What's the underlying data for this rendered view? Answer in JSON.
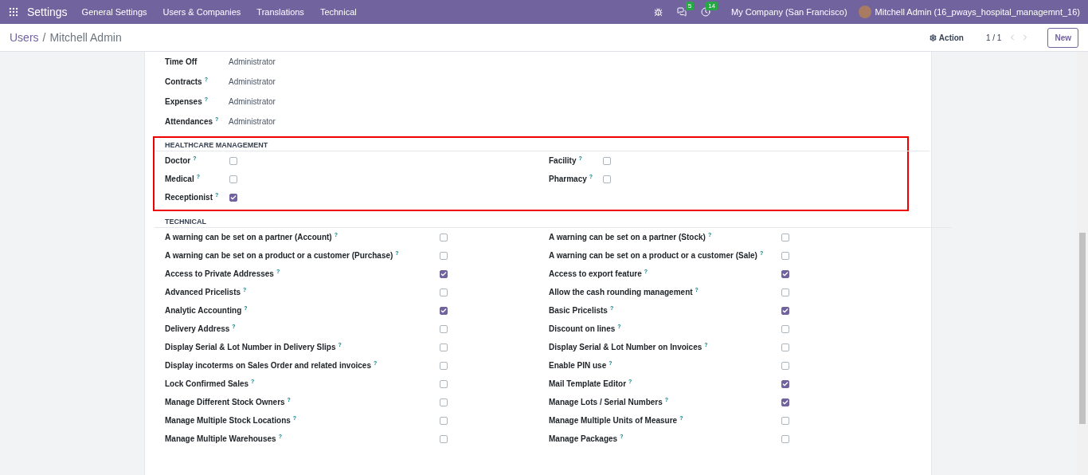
{
  "navbar": {
    "app": "Settings",
    "menus": [
      "General Settings",
      "Users & Companies",
      "Translations",
      "Technical"
    ],
    "messages_count": "5",
    "activities_count": "14",
    "company": "My Company (San Francisco)",
    "user": "Mitchell Admin (16_pways_hospital_managemnt_16)"
  },
  "control_panel": {
    "breadcrumb_parent": "Users",
    "separator": "/",
    "breadcrumb_current": "Mitchell Admin",
    "action": "Action",
    "pager": "1 / 1",
    "new_button": "New"
  },
  "access_rows": [
    {
      "label": "Time Off",
      "value": "Administrator"
    },
    {
      "label": "Contracts",
      "help": "?",
      "value": "Administrator"
    },
    {
      "label": "Expenses",
      "help": "?",
      "value": "Administrator"
    },
    {
      "label": "Attendances",
      "help": "?",
      "value": "Administrator"
    }
  ],
  "sections": [
    {
      "title": "HEALTHCARE MANAGEMENT",
      "kind": "compact",
      "highlighted": true,
      "left": [
        {
          "label": "Doctor",
          "help": "?",
          "checked": false
        },
        {
          "label": "Medical",
          "help": "?",
          "checked": false
        },
        {
          "label": "Receptionist",
          "help": "?",
          "checked": true
        }
      ],
      "right": [
        {
          "label": "Facility",
          "help": "?",
          "checked": false
        },
        {
          "label": "Pharmacy",
          "help": "?",
          "checked": false
        }
      ]
    },
    {
      "title": "TECHNICAL",
      "kind": "wide",
      "highlighted": false,
      "left": [
        {
          "label": "A warning can be set on a partner (Account)",
          "help": "?",
          "checked": false
        },
        {
          "label": "A warning can be set on a product or a customer (Purchase)",
          "help": "?",
          "checked": false
        },
        {
          "label": "Access to Private Addresses",
          "help": "?",
          "checked": true
        },
        {
          "label": "Advanced Pricelists",
          "help": "?",
          "checked": false
        },
        {
          "label": "Analytic Accounting",
          "help": "?",
          "checked": true
        },
        {
          "label": "Delivery Address",
          "help": "?",
          "checked": false
        },
        {
          "label": "Display Serial & Lot Number in Delivery Slips",
          "help": "?",
          "checked": false
        },
        {
          "label": "Display incoterms on Sales Order and related invoices",
          "help": "?",
          "checked": false
        },
        {
          "label": "Lock Confirmed Sales",
          "help": "?",
          "checked": false
        },
        {
          "label": "Manage Different Stock Owners",
          "help": "?",
          "checked": false
        },
        {
          "label": "Manage Multiple Stock Locations",
          "help": "?",
          "checked": false
        },
        {
          "label": "Manage Multiple Warehouses",
          "help": "?",
          "checked": false
        }
      ],
      "right": [
        {
          "label": "A warning can be set on a partner (Stock)",
          "help": "?",
          "checked": false
        },
        {
          "label": "A warning can be set on a product or a customer (Sale)",
          "help": "?",
          "checked": false
        },
        {
          "label": "Access to export feature",
          "help": "?",
          "checked": true
        },
        {
          "label": "Allow the cash rounding management",
          "help": "?",
          "checked": false
        },
        {
          "label": "Basic Pricelists",
          "help": "?",
          "checked": true
        },
        {
          "label": "Discount on lines",
          "help": "?",
          "checked": false
        },
        {
          "label": "Display Serial & Lot Number on Invoices",
          "help": "?",
          "checked": false
        },
        {
          "label": "Enable PIN use",
          "help": "?",
          "checked": false
        },
        {
          "label": "Mail Template Editor",
          "help": "?",
          "checked": true
        },
        {
          "label": "Manage Lots / Serial Numbers",
          "help": "?",
          "checked": true
        },
        {
          "label": "Manage Multiple Units of Measure",
          "help": "?",
          "checked": false
        },
        {
          "label": "Manage Packages",
          "help": "?",
          "checked": false
        }
      ]
    }
  ]
}
